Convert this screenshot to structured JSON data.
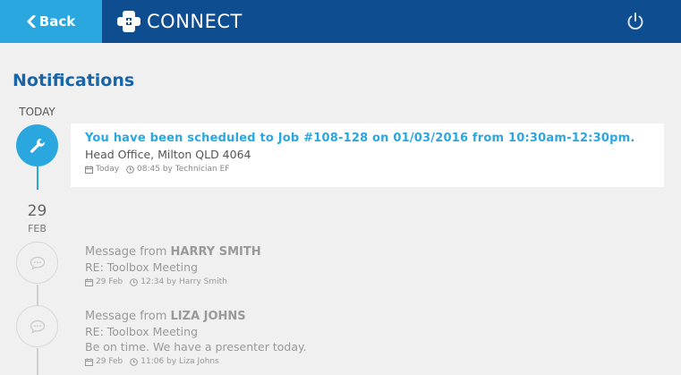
{
  "header": {
    "back_label": "Back",
    "app_name": "CONNECT",
    "colors": {
      "bar": "#0e4d8f",
      "back": "#2ba7e0"
    }
  },
  "page": {
    "title": "Notifications"
  },
  "groups": {
    "today": {
      "label": "TODAY"
    },
    "feb29": {
      "day": "29",
      "month": "FEB"
    }
  },
  "notifications": [
    {
      "icon": "wrench-icon",
      "title": "You have been scheduled to Job #108-128 on 01/03/2016 from 10:30am-12:30pm.",
      "body": "Head Office, Milton QLD 4064",
      "date": "Today",
      "time": "08:45 by Technician EF"
    },
    {
      "icon": "chat-bubble-icon",
      "prefix": "Message from",
      "sender": "HARRY SMITH",
      "subject": "RE: Toolbox Meeting",
      "date": "29 Feb",
      "time": "12:34 by Harry Smith"
    },
    {
      "icon": "chat-bubble-icon",
      "prefix": "Message from",
      "sender": "LIZA JOHNS",
      "subject": "RE: Toolbox Meeting",
      "body": "Be on time. We have a presenter today.",
      "date": "29 Feb",
      "time": "11:06 by Liza Johns"
    }
  ]
}
